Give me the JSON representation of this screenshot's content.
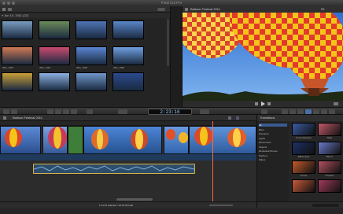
{
  "window": {
    "title": "Final Cut Pro"
  },
  "browser": {
    "date_header": "Jun 10, 2011",
    "clip_count": "(22)",
    "clips": [
      {
        "label": "",
        "color": "#7a9cc0"
      },
      {
        "label": "",
        "color": "#6b8a5a"
      },
      {
        "label": "",
        "color": "#4f74b5"
      },
      {
        "label": "",
        "color": "#5b87c9"
      },
      {
        "label": "IMG_1045",
        "color": "#d07a54"
      },
      {
        "label": "IMG_1046",
        "color": "#c94b6f"
      },
      {
        "label": "IMG_1048",
        "color": "#5a86d2"
      },
      {
        "label": "IMG_1050",
        "color": "#6fa0e0"
      },
      {
        "label": "",
        "color": "#c9a03a"
      },
      {
        "label": "",
        "color": "#8cb0e0"
      },
      {
        "label": "",
        "color": "#7096c8"
      },
      {
        "label": "",
        "color": "#2b4a8e"
      }
    ],
    "status": "1 of 22 selected, 10:06"
  },
  "viewer": {
    "title": "Balloon Festival 2011",
    "zoom": "Fit"
  },
  "toolbar": {
    "timecode": "2:23:16"
  },
  "timeline": {
    "title": "Balloon Festival 2011",
    "status": "1:14:15 selected • 02:13:06 total"
  },
  "transitions": {
    "title": "Transitions",
    "categories": [
      "All",
      "Blurs",
      "Dissolves",
      "Lights",
      "Movements",
      "Objects",
      "Replicator/Clones",
      "Stylized",
      "Wipes"
    ],
    "items": [
      {
        "label": "Cross Dissolve",
        "color": "#3a5aa0"
      },
      {
        "label": "Slide",
        "color": "#c05a6a"
      },
      {
        "label": "Black Hole",
        "color": "#1d2f66"
      },
      {
        "label": "Bloom",
        "color": "#6a7ac8"
      },
      {
        "label": "Center",
        "color": "#c25a2a"
      },
      {
        "label": "Checker",
        "color": "#b05060"
      },
      {
        "label": "",
        "color": "#c85a3a"
      },
      {
        "label": "",
        "color": "#a03a5a"
      }
    ]
  }
}
